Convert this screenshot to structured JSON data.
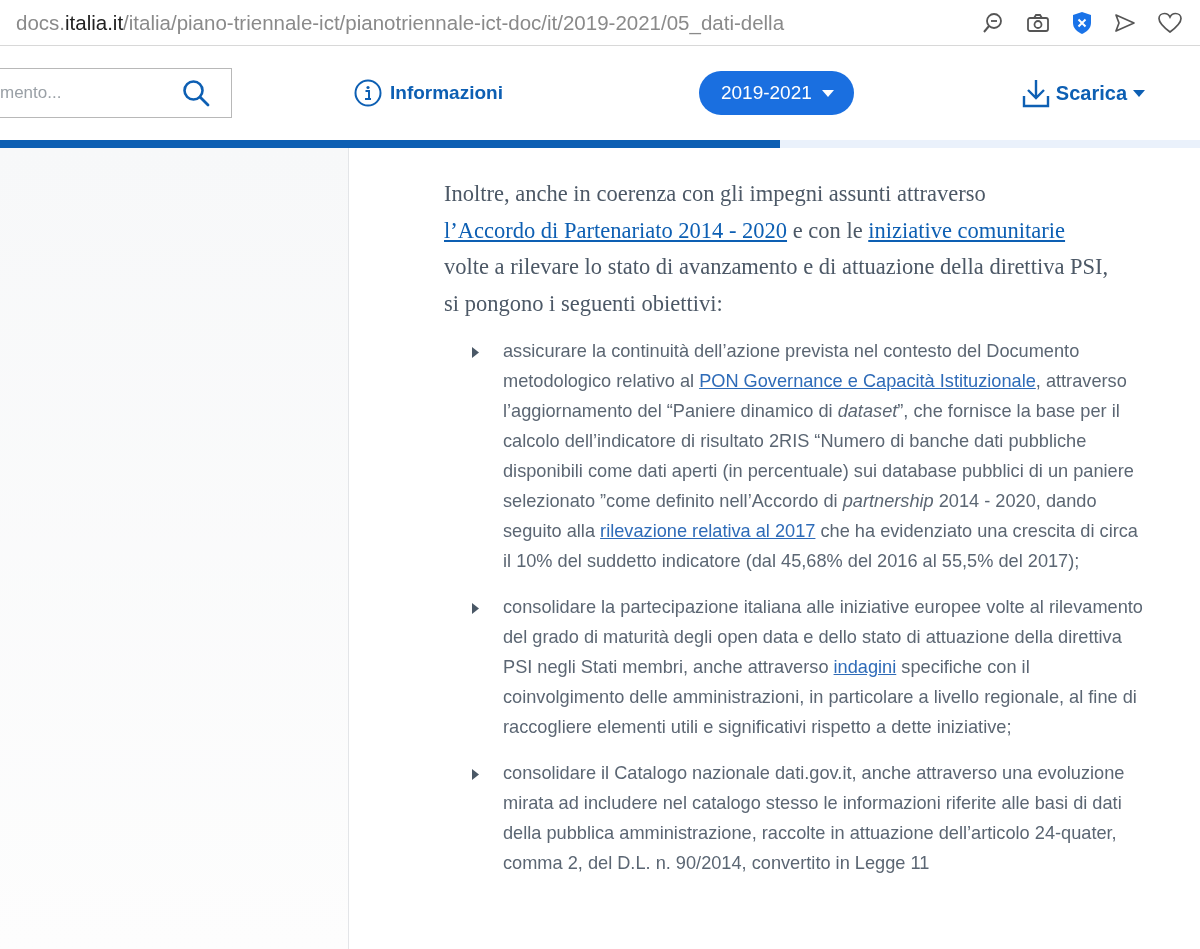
{
  "address_bar": {
    "url": "docs.**italia.it**/italia/piano-triennale-ict/pianotriennale-ict-doc/it/2019-2021/05_dati-della"
  },
  "header": {
    "search": {
      "placeholder": "mento..."
    },
    "info_link": "Informazioni",
    "version": "2019-2021",
    "download": "Scarica"
  },
  "reading_progress": {
    "level": 0.65
  },
  "intro": [
    {
      "kind": "text",
      "text": "Inoltre, anche in coerenza con gli impegni assunti attraverso "
    },
    {
      "kind": "link",
      "text": "l’Accordo di Partenariato 2014 - 2020"
    },
    {
      "kind": "text",
      "text": " e con le "
    },
    {
      "kind": "link",
      "text": "iniziative comunitarie"
    },
    {
      "kind": "text",
      "text": " volte a rilevare lo stato di avanzamento e di attuazione della direttiva PSI, si pongono i seguenti obiettivi:"
    }
  ],
  "objectives": [
    [
      {
        "kind": "text",
        "text": "assicurare la continuità dell’azione prevista nel contesto del Documento metodologico relativo al "
      },
      {
        "kind": "link",
        "text": "PON Governance e Capacità Istituzionale"
      },
      {
        "kind": "text",
        "text": ", attraverso l’aggiornamento del “Paniere dinamico di *dataset*”, che fornisce la base per il calcolo dell’indicatore di risultato 2RIS “Numero di banche dati pubbliche disponibili come dati aperti (in percentuale) sui database pubblici di un paniere selezionato ”come definito nell’Accordo di *partnership* 2014 - 2020, dando seguito alla "
      },
      {
        "kind": "link",
        "text": "rilevazione relativa al 2017"
      },
      {
        "kind": "text",
        "text": " che ha evidenziato una crescita di circa il 10% del suddetto indicatore (dal 45,68% del 2016 al 55,5% del 2017);"
      }
    ],
    [
      {
        "kind": "text",
        "text": "consolidare la partecipazione italiana alle iniziative europee volte al rilevamento del grado di maturità degli open data e dello stato di attuazione della direttiva PSI negli Stati membri, anche attraverso "
      },
      {
        "kind": "link",
        "text": "indagini"
      },
      {
        "kind": "text",
        "text": " specifiche con il coinvolgimento delle amministrazioni, in particolare a livello regionale, al fine di raccogliere elementi utili e significativi rispetto a dette iniziative;"
      }
    ],
    [
      {
        "kind": "text",
        "text": "consolidare il Catalogo nazionale dati.gov.it, anche attraverso una evoluzione mirata ad includere nel catalogo stesso le informazioni riferite alle basi di dati della pubblica amministrazione, raccolte in attuazione dell’articolo 24-quater, comma 2, del D.L. n. 90/2014, convertito in Legge 11"
      }
    ]
  ]
}
